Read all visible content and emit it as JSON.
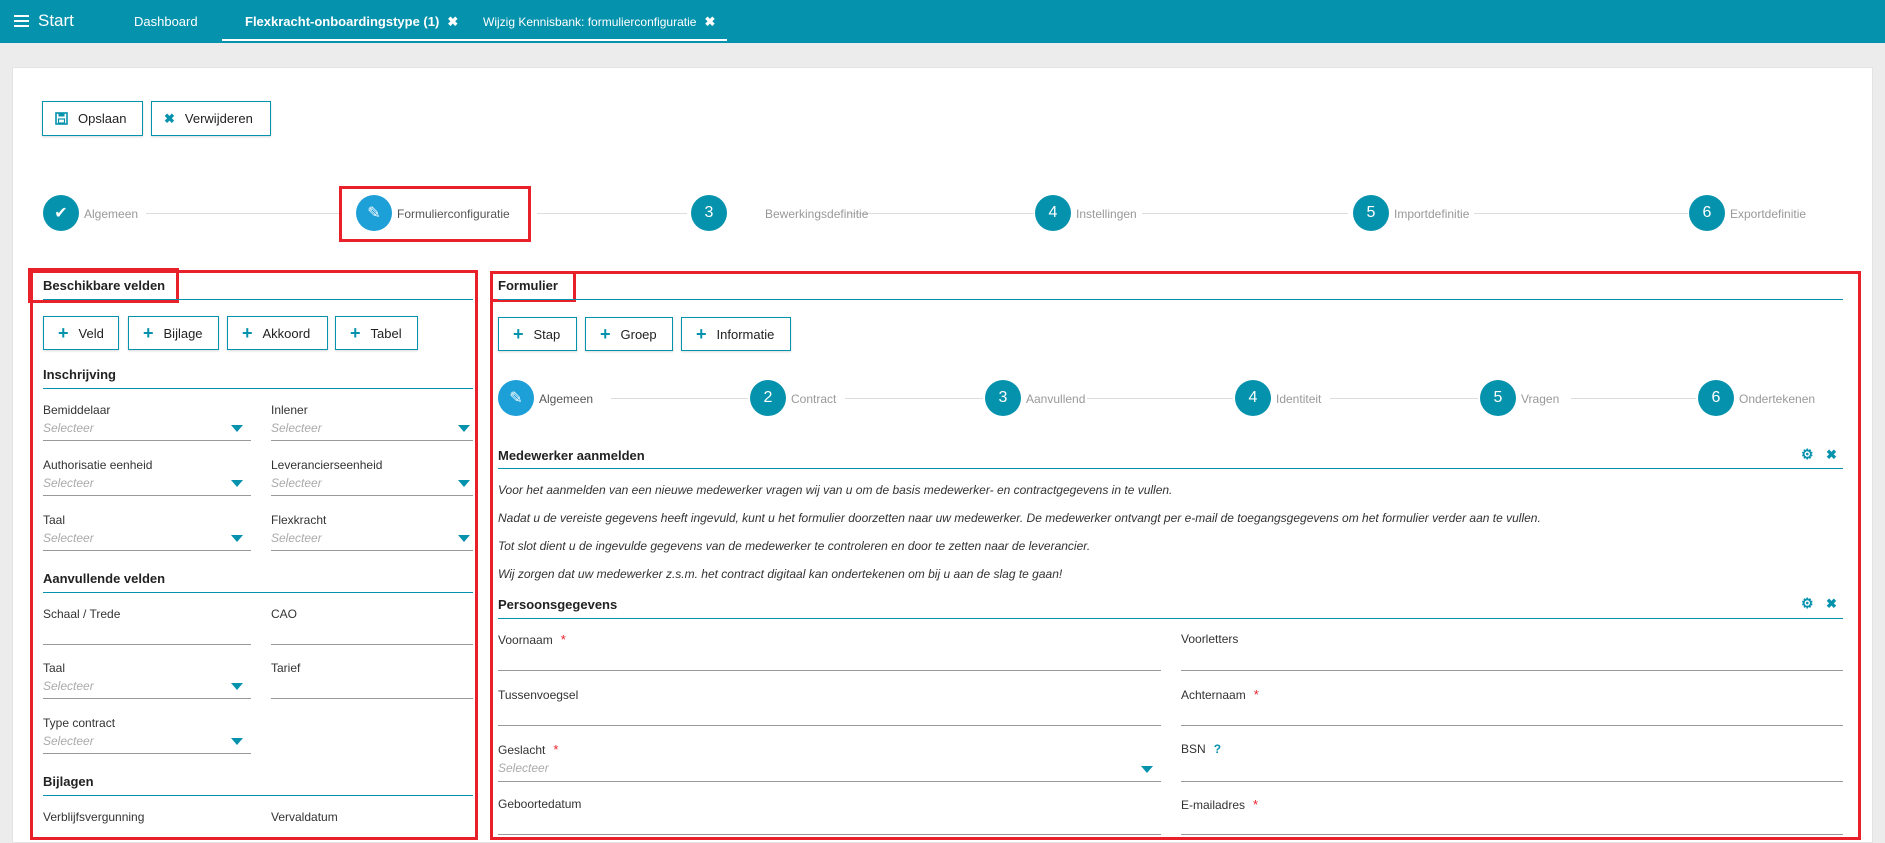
{
  "topbar": {
    "start_label": "Start",
    "tabs": [
      {
        "label": "Dashboard"
      },
      {
        "label": "Flexkracht-onboardingstype (1)",
        "close": "✖"
      },
      {
        "label": "Wijzig Kennisbank: formulierconfiguratie",
        "close": "✖"
      }
    ]
  },
  "toolbar": {
    "save_label": "Opslaan",
    "delete_label": "Verwijderen"
  },
  "wizard": {
    "steps": [
      {
        "number": "✔",
        "label": "Algemeen",
        "state": "done"
      },
      {
        "number": "✎",
        "label": "Formulierconfiguratie",
        "state": "current"
      },
      {
        "number": "3",
        "label": "Bewerkingsdefinitie",
        "state": "todo"
      },
      {
        "number": "4",
        "label": "Instellingen",
        "state": "todo"
      },
      {
        "number": "5",
        "label": "Importdefinitie",
        "state": "todo"
      },
      {
        "number": "6",
        "label": "Exportdefinitie",
        "state": "todo"
      }
    ]
  },
  "left": {
    "title": "Beschikbare velden",
    "buttons": [
      "Veld",
      "Bijlage",
      "Akkoord",
      "Tabel"
    ],
    "sections": {
      "inschrijving": "Inschrijving",
      "aanvullend": "Aanvullende velden",
      "bijlagen": "Bijlagen"
    },
    "fields": {
      "bemiddelaar": "Bemiddelaar",
      "inlener": "Inlener",
      "authorisatie": "Authorisatie eenheid",
      "leverancier": "Leverancierseenheid",
      "taal": "Taal",
      "flexkracht": "Flexkracht",
      "schaal": "Schaal / Trede",
      "cao": "CAO",
      "taal2": "Taal",
      "tarief": "Tarief",
      "type_contract": "Type contract",
      "verblijf": "Verblijfsvergunning",
      "vervaldatum": "Vervaldatum"
    },
    "select_placeholder": "Selecteer"
  },
  "right": {
    "title": "Formulier",
    "buttons": [
      "Stap",
      "Groep",
      "Informatie"
    ],
    "steps": [
      {
        "number": "✎",
        "label": "Algemeen"
      },
      {
        "number": "2",
        "label": "Contract"
      },
      {
        "number": "3",
        "label": "Aanvullend"
      },
      {
        "number": "4",
        "label": "Identiteit"
      },
      {
        "number": "5",
        "label": "Vragen"
      },
      {
        "number": "6",
        "label": "Ondertekenen"
      }
    ],
    "group1_title": "Medewerker aanmelden",
    "intro": [
      "Voor het aanmelden van een nieuwe medewerker vragen wij van u om de basis medewerker- en contractgegevens in te vullen.",
      "Nadat u de vereiste gegevens heeft ingevuld, kunt u het formulier doorzetten naar uw medewerker. De medewerker ontvangt per e-mail de toegangsgegevens om het formulier verder aan te vullen.",
      "Tot slot dient u de ingevulde gegevens van de medewerker te controleren en door te zetten naar de leverancier.",
      "Wij zorgen dat uw medewerker z.s.m. het contract digitaal kan ondertekenen om bij u aan de slag te gaan!"
    ],
    "group2_title": "Persoonsgegevens",
    "fields": {
      "voornaam": "Voornaam",
      "voorletters": "Voorletters",
      "tussenvoegsel": "Tussenvoegsel",
      "achternaam": "Achternaam",
      "geslacht": "Geslacht",
      "bsn": "BSN",
      "geboortedatum": "Geboortedatum",
      "email": "E-mailadres"
    },
    "required_mark": "*",
    "help_mark": "?",
    "select_placeholder": "Selecteer"
  },
  "colors": {
    "accent": "#0592ad",
    "highlight": "#e8202a"
  }
}
